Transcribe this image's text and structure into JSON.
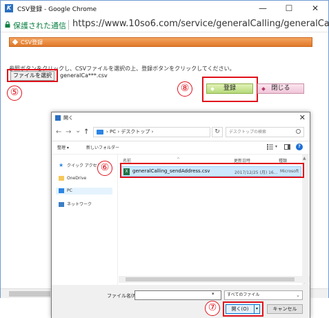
{
  "window": {
    "title": "CSV登録 - Google Chrome",
    "minimize_glyph": "—",
    "maximize_glyph": "☐",
    "close_glyph": "✕"
  },
  "address_bar": {
    "secure_label": "保護された通信",
    "url": "https://www.10so6.com/service/generalCalling/generalCallin"
  },
  "page": {
    "header_title": "CSV登録",
    "instructions": "参照ボタンをクリックし、CSVファイルを選択の上、登録ボタンをクリックしてください。",
    "file_button_label": "ファイルを選択",
    "chosen_file": "generalCa***.csv",
    "register_button_label": "登録",
    "close_button_label": "閉じる"
  },
  "steps": {
    "step5": "⑤",
    "step6": "⑥",
    "step7": "⑦",
    "step8": "⑧"
  },
  "dialog": {
    "title": "開く",
    "close_glyph": "✕",
    "back_glyph": "←",
    "forward_glyph": "→",
    "recent_glyph": "⌄",
    "up_glyph": "↑",
    "path": "› PC › デスクトップ ›",
    "search_placeholder": "デスクトップの検索",
    "toolbar": {
      "organize": "整理 ▾",
      "new_folder": "新しいフォルダー",
      "help": "?"
    },
    "nav_items": [
      {
        "label": "クイック アクセス"
      },
      {
        "label": "OneDrive"
      },
      {
        "label": "PC"
      },
      {
        "label": "ネットワーク"
      }
    ],
    "columns": {
      "name": "名前",
      "date": "更新日時",
      "type": "種類"
    },
    "file": {
      "name": "generalCalling_sendAddress.csv",
      "date": "2017/12/25 (月) 16...",
      "type": "Microsoft"
    },
    "filename_label": "ファイル名(N):",
    "filename_value": "",
    "filetype_selected": "すべてのファイル",
    "open_button_label": "開く(O)",
    "cancel_button_label": "キャンセル"
  },
  "colors": {
    "highlight_red": "#e0101a",
    "header_orange": "#e0792a",
    "secure_green": "#0b8043",
    "selected_row": "#cce8ff"
  }
}
